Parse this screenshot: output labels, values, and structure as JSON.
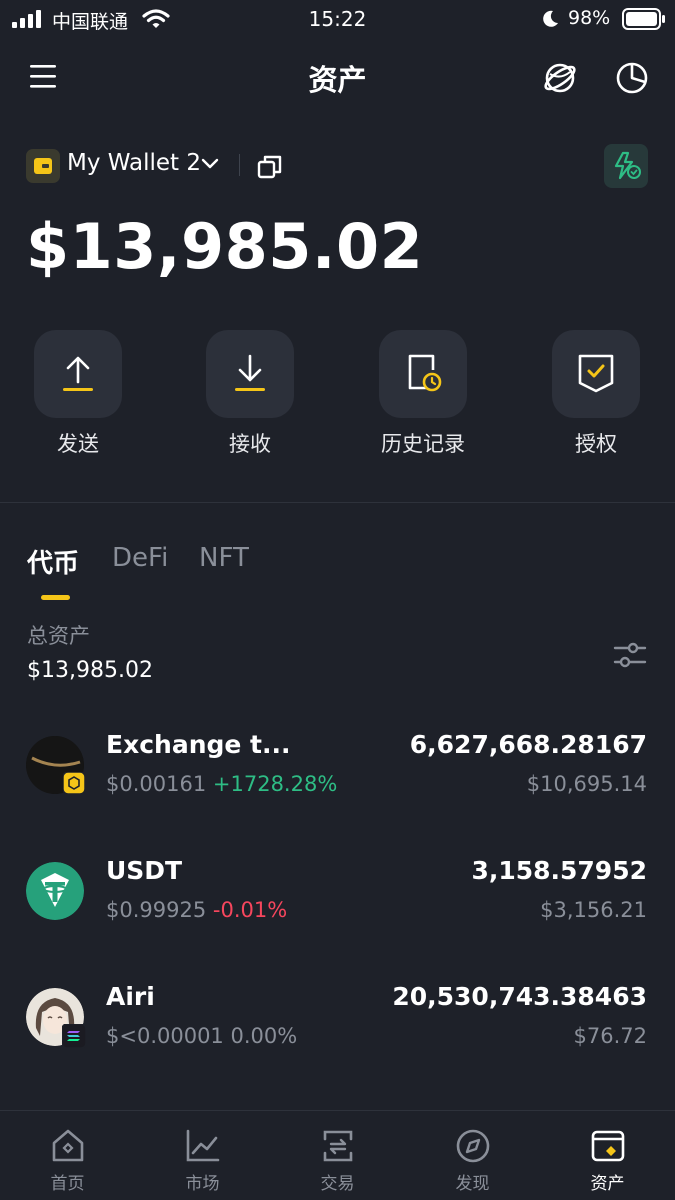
{
  "status_bar": {
    "carrier": "中国联通",
    "time": "15:22",
    "battery": "98%"
  },
  "header": {
    "title": "资产",
    "icons": [
      "menu-icon",
      "globe-icon",
      "pie-chart-icon"
    ]
  },
  "wallet": {
    "name": "My Wallet 2",
    "balance": "$13,985.02"
  },
  "actions": [
    {
      "label": "发送",
      "icon": "arrow-up-icon"
    },
    {
      "label": "接收",
      "icon": "arrow-down-icon"
    },
    {
      "label": "历史记录",
      "icon": "history-icon"
    },
    {
      "label": "授权",
      "icon": "shield-check-icon"
    }
  ],
  "tabs": [
    "代币",
    "DeFi",
    "NFT"
  ],
  "total": {
    "label": "总资产",
    "value": "$13,985.02"
  },
  "tokens": [
    {
      "name": "Exchange t...",
      "price": "$0.00161",
      "change": "+1728.28%",
      "amount": "6,627,668.28167",
      "value": "$10,695.14"
    },
    {
      "name": "USDT",
      "price": "$0.99925",
      "change": "-0.01%",
      "amount": "3,158.57952",
      "value": "$3,156.21"
    },
    {
      "name": "Airi",
      "price": "$<0.00001",
      "change": "0.00%",
      "amount": "20,530,743.38463",
      "value": "$76.72"
    }
  ],
  "nav": [
    {
      "label": "首页",
      "icon": "home-icon"
    },
    {
      "label": "市场",
      "icon": "chart-icon"
    },
    {
      "label": "交易",
      "icon": "swap-icon"
    },
    {
      "label": "发现",
      "icon": "compass-icon"
    },
    {
      "label": "资产",
      "icon": "wallet-icon"
    }
  ],
  "colors": {
    "background": "#1e2129",
    "accent": "#f5c518",
    "up": "#2ebd85",
    "down": "#f6465d",
    "muted": "#8a8f99"
  }
}
